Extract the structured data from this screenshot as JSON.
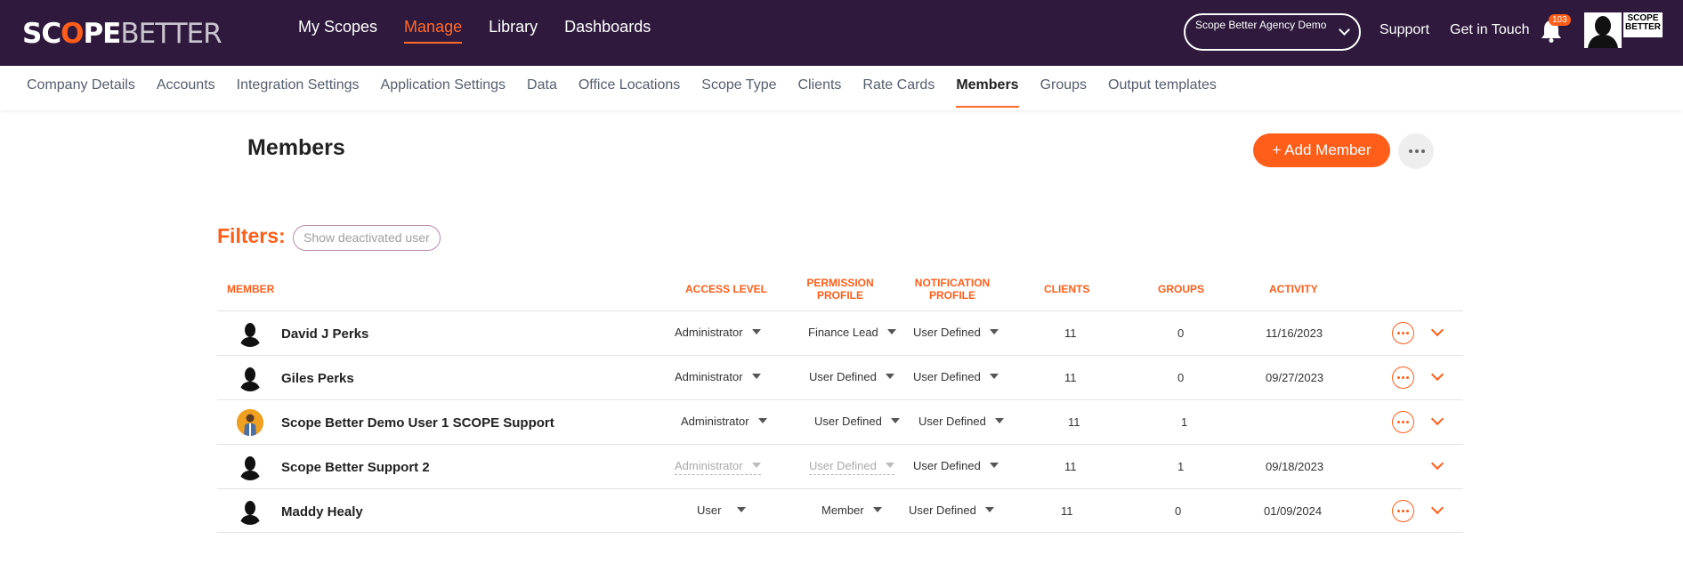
{
  "topbar": {
    "logo": {
      "scope_a": "SC",
      "scope_o": "O",
      "scope_b": "PE",
      "better": "BETTER"
    },
    "nav": [
      {
        "label": "My Scopes",
        "active": false
      },
      {
        "label": "Manage",
        "active": true
      },
      {
        "label": "Library",
        "active": false
      },
      {
        "label": "Dashboards",
        "active": false
      }
    ],
    "agency_select": "Scope Better Agency Demo",
    "support": "Support",
    "get_in_touch": "Get in Touch",
    "notification_count": "103",
    "mini_logo": "SCOPE BETTER",
    "accent_color": "#ff5e1a",
    "bar_color": "#2f1a3d"
  },
  "subnav": {
    "items": [
      "Company Details",
      "Accounts",
      "Integration Settings",
      "Application Settings",
      "Data",
      "Office Locations",
      "Scope Type",
      "Clients",
      "Rate Cards",
      "Members",
      "Groups",
      "Output templates"
    ],
    "active": "Members"
  },
  "page": {
    "title": "Members",
    "add_button": "+ Add Member",
    "filters_label": "Filters:",
    "filter_chip": "Show deactivated user"
  },
  "table": {
    "headers": {
      "member": "MEMBER",
      "access_level": "ACCESS LEVEL",
      "permission_profile_1": "PERMISSION",
      "permission_profile_2": "PROFILE",
      "notification_profile_1": "NOTIFICATION",
      "notification_profile_2": "PROFILE",
      "clients": "CLIENTS",
      "groups": "GROUPS",
      "activity": "ACTIVITY"
    },
    "rows": [
      {
        "name": "David J Perks",
        "access": "Administrator",
        "permission": "Finance Lead",
        "notification": "User Defined",
        "clients": "11",
        "groups": "0",
        "activity": "11/16/2023"
      },
      {
        "name": "Giles Perks",
        "access": "Administrator",
        "permission": "User Defined",
        "notification": "User Defined",
        "clients": "11",
        "groups": "0",
        "activity": "09/27/2023"
      },
      {
        "name": "Scope Better Demo User 1 SCOPE Support",
        "access": "Administrator",
        "permission": "User Defined",
        "notification": "User Defined",
        "clients": "11",
        "groups": "1",
        "activity": ""
      },
      {
        "name": "Scope Better Support 2",
        "access": "Administrator",
        "permission": "User Defined",
        "notification": "User Defined",
        "clients": "11",
        "groups": "1",
        "activity": "09/18/2023"
      },
      {
        "name": "Maddy Healy",
        "access": "User",
        "permission": "Member",
        "notification": "User Defined",
        "clients": "11",
        "groups": "0",
        "activity": "01/09/2024"
      }
    ]
  }
}
